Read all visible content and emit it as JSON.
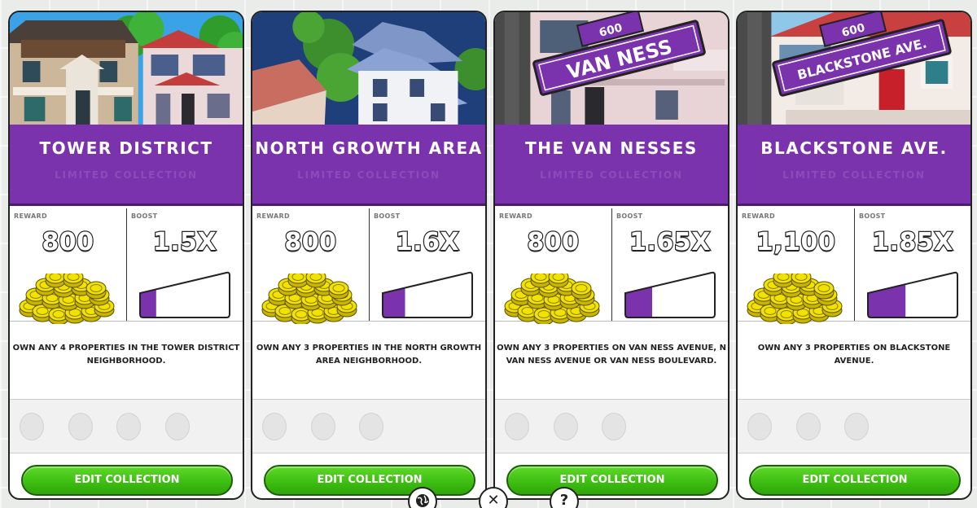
{
  "cards": [
    {
      "title": "TOWER DISTRICT",
      "subtitle": "LIMITED COLLECTION",
      "reward_label": "REWARD",
      "reward_value": "800",
      "boost_label": "BOOST",
      "boost_value": "1.5X",
      "boost_level": 0.18,
      "description": "OWN ANY 4 PROPERTIES IN THE TOWER DISTRICT\nNEIGHBORHOOD.",
      "slots": 4,
      "button_label": "EDIT COLLECTION"
    },
    {
      "title": "NORTH GROWTH AREA",
      "subtitle": "LIMITED COLLECTION",
      "reward_label": "REWARD",
      "reward_value": "800",
      "boost_label": "BOOST",
      "boost_value": "1.6X",
      "boost_level": 0.25,
      "description": "OWN ANY 3 PROPERTIES IN THE NORTH GROWTH\nAREA NEIGHBORHOOD.",
      "slots": 3,
      "button_label": "EDIT COLLECTION"
    },
    {
      "title": "THE VAN NESSES",
      "subtitle": "LIMITED COLLECTION",
      "reward_label": "REWARD",
      "reward_value": "800",
      "boost_label": "BOOST",
      "boost_value": "1.65X",
      "boost_level": 0.3,
      "description": "OWN ANY 3 PROPERTIES ON VAN NESS AVENUE, N\nVAN NESS AVENUE OR VAN NESS BOULEVARD.",
      "slots": 3,
      "button_label": "EDIT COLLECTION",
      "sign_number": "600",
      "sign_text": "VAN NESS"
    },
    {
      "title": "BLACKSTONE AVE.",
      "subtitle": "LIMITED COLLECTION",
      "reward_label": "REWARD",
      "reward_value": "1,100",
      "boost_label": "BOOST",
      "boost_value": "1.85X",
      "boost_level": 0.42,
      "description": "OWN ANY 3 PROPERTIES ON BLACKSTONE\nAVENUE.",
      "slots": 3,
      "button_label": "EDIT COLLECTION",
      "sign_number": "600",
      "sign_text": "BLACKSTONE AVE."
    }
  ],
  "bottom_bar": {
    "globe_icon": "globe-icon",
    "close_icon": "close-icon",
    "close_glyph": "✕",
    "help_icon": "help-icon",
    "help_glyph": "?"
  },
  "colors": {
    "purple": "#7a33ad",
    "green": "#3ebf12",
    "coin": "#f2e200"
  }
}
